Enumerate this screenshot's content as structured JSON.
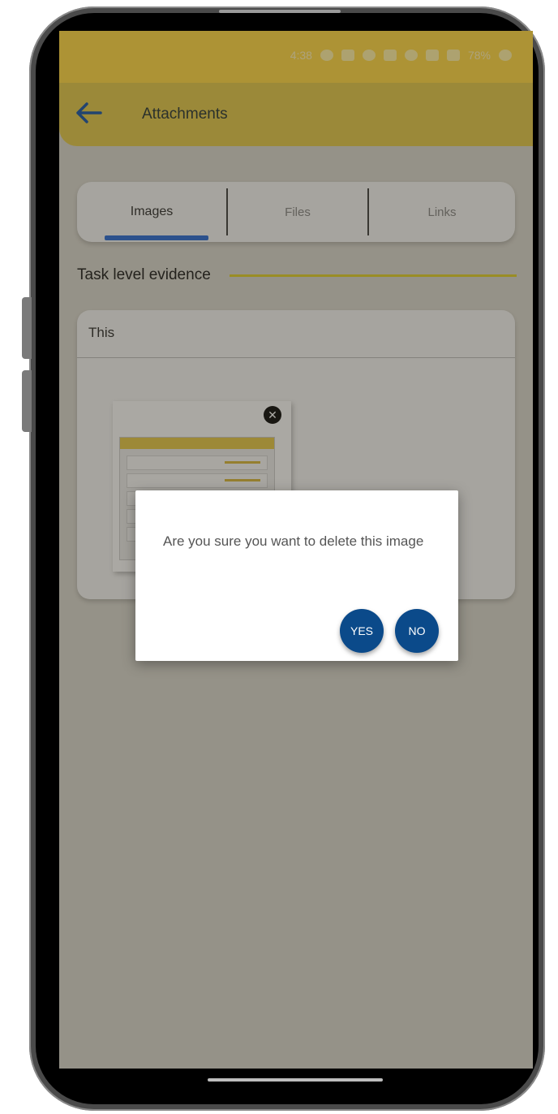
{
  "status_bar": {
    "time": "4:38",
    "battery": "78%"
  },
  "app_bar": {
    "title": "Attachments"
  },
  "tabs": [
    {
      "label": "Images",
      "active": true
    },
    {
      "label": "Files",
      "active": false
    },
    {
      "label": "Links",
      "active": false
    }
  ],
  "section": {
    "title": "Task level evidence"
  },
  "card": {
    "title": "This"
  },
  "dialog": {
    "message": "Are you sure you want to delete this image",
    "yes_label": "YES",
    "no_label": "NO"
  },
  "colors": {
    "status_bar": "#ffd84a",
    "app_bar": "#e3c94f",
    "tab_indicator": "#2f6fd6",
    "section_line": "#e0cf30",
    "dialog_button": "#0b4a8a"
  }
}
